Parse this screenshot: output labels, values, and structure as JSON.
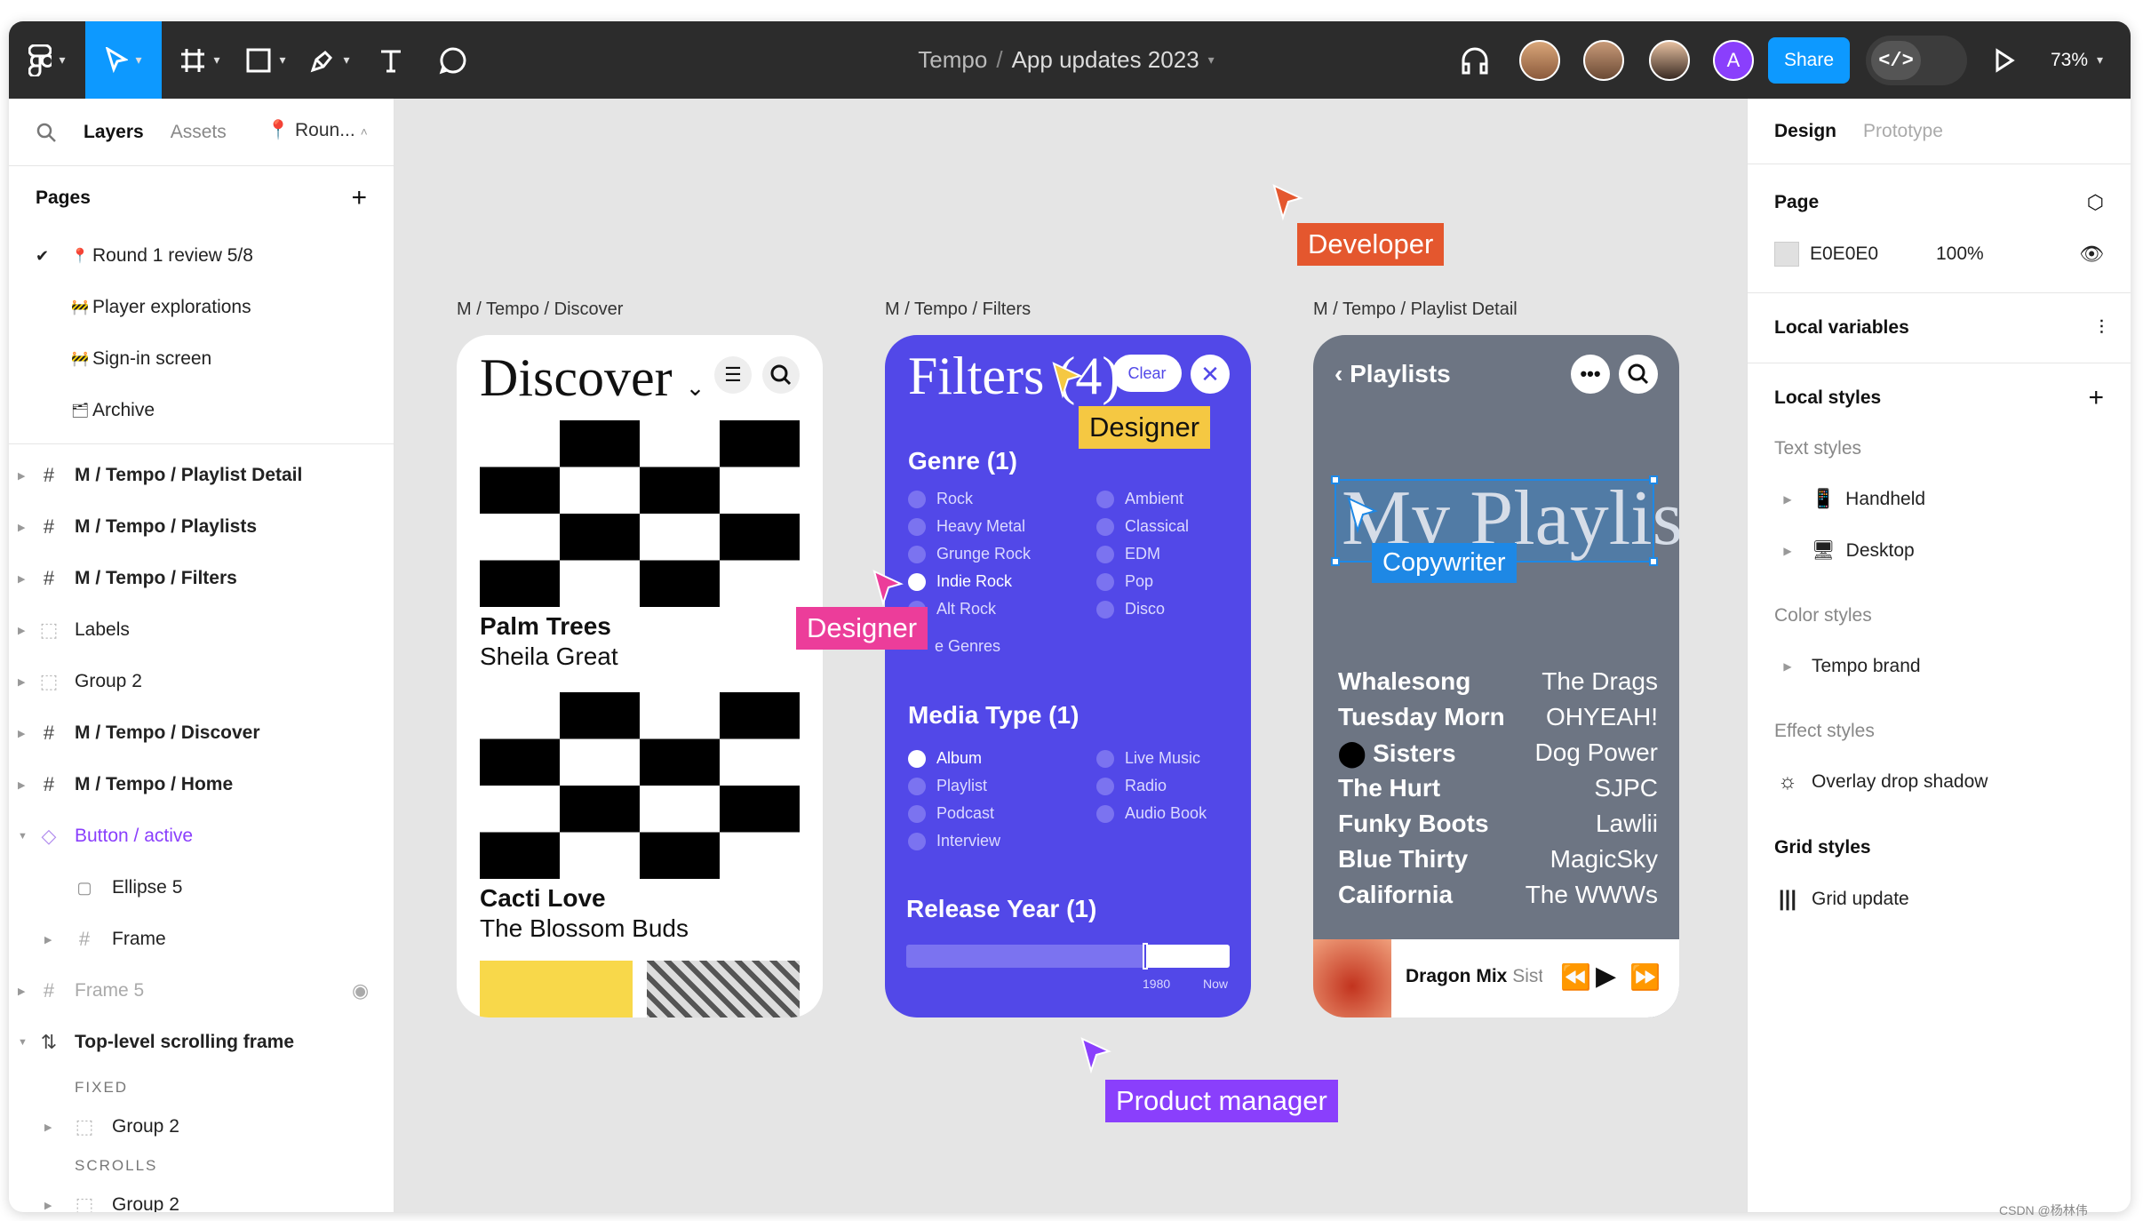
{
  "toolbar": {
    "doc_project": "Tempo",
    "doc_sep": "/",
    "doc_name": "App updates 2023",
    "share_label": "Share",
    "dev_label": "</>",
    "zoom": "73%",
    "avatar_letter": "A"
  },
  "left": {
    "tabs": {
      "layers": "Layers",
      "assets": "Assets",
      "page_pill": "Roun..."
    },
    "pages_title": "Pages",
    "pages": [
      {
        "emoji": "📍",
        "label": "Round 1 review 5/8"
      },
      {
        "emoji": "🚧",
        "label": "Player explorations"
      },
      {
        "emoji": "🚧",
        "label": "Sign-in screen"
      },
      {
        "emoji": "🗂",
        "label": "Archive"
      }
    ],
    "layers": [
      "M / Tempo / Playlist Detail",
      "M / Tempo / Playlists",
      "M / Tempo / Filters",
      "Labels",
      "Group 2",
      "M / Tempo / Discover",
      "M / Tempo / Home",
      "Button / active",
      "Ellipse 5",
      "Frame",
      "Frame 5",
      "Top-level scrolling frame",
      "Group 2",
      "Group 2"
    ],
    "sections": {
      "fixed": "FIXED",
      "scrolls": "SCROLLS"
    }
  },
  "right": {
    "tabs": {
      "design": "Design",
      "prototype": "Prototype"
    },
    "page_title": "Page",
    "page_color": "E0E0E0",
    "page_opacity": "100%",
    "local_variables": "Local variables",
    "local_styles": "Local styles",
    "text_styles": "Text styles",
    "text_style_items": [
      "Handheld",
      "Desktop"
    ],
    "color_styles": "Color styles",
    "color_style_items": [
      "Tempo brand"
    ],
    "effect_styles": "Effect styles",
    "effect_style_items": [
      "Overlay drop shadow"
    ],
    "grid_styles": "Grid styles",
    "grid_style_items": [
      "Grid update"
    ]
  },
  "canvas": {
    "frame_labels": [
      "M / Tempo / Discover",
      "M / Tempo / Filters",
      "M / Tempo / Playlist Detail"
    ],
    "cursors": {
      "developer": "Developer",
      "designer1": "Designer",
      "designer2": "Designer",
      "copywriter": "Copywriter",
      "pm": "Product manager"
    },
    "cursor_colors": {
      "developer": "#e4572e",
      "designer_pink": "#ec3d9a",
      "designer_yellow": "#f5c842",
      "copywriter": "#1e88e5",
      "pm": "#8a3ffc"
    },
    "discover": {
      "title": "Discover",
      "cards": [
        {
          "title": "Palm Trees",
          "artist": "Sheila Great"
        },
        {
          "title": "Cacti Love",
          "artist": "The Blossom Buds"
        }
      ]
    },
    "filters": {
      "title": "Filters (4)",
      "clear": "Clear",
      "genre_title": "Genre (1)",
      "genres_left": [
        "Rock",
        "Heavy Metal",
        "Grunge Rock",
        "Indie Rock",
        "Alt Rock"
      ],
      "genres_right": [
        "Ambient",
        "Classical",
        "EDM",
        "Pop",
        "Disco"
      ],
      "more_genres": "e Genres",
      "media_title": "Media Type (1)",
      "media_left": [
        "Album",
        "Playlist",
        "Podcast",
        "Interview"
      ],
      "media_right": [
        "Live Music",
        "Radio",
        "Audio Book"
      ],
      "year_title": "Release Year (1)",
      "year_min": "1980",
      "year_max": "Now"
    },
    "playlist": {
      "back_label": "Playlists",
      "title": "My Playlist",
      "tracks": [
        {
          "name": "Whalesong",
          "artist": "The Drags"
        },
        {
          "name": "Tuesday Morn",
          "artist": "OHYEAH!"
        },
        {
          "name": "Sisters",
          "artist": "Dog Power"
        },
        {
          "name": "The Hurt",
          "artist": "SJPC"
        },
        {
          "name": "Funky Boots",
          "artist": "Lawlii"
        },
        {
          "name": "Blue Thirty",
          "artist": "MagicSky"
        },
        {
          "name": "California",
          "artist": "The WWWs"
        }
      ],
      "now_playing": "Dragon Mix",
      "now_playing_sub": "Siste"
    }
  },
  "watermark": "CSDN @杨林伟"
}
